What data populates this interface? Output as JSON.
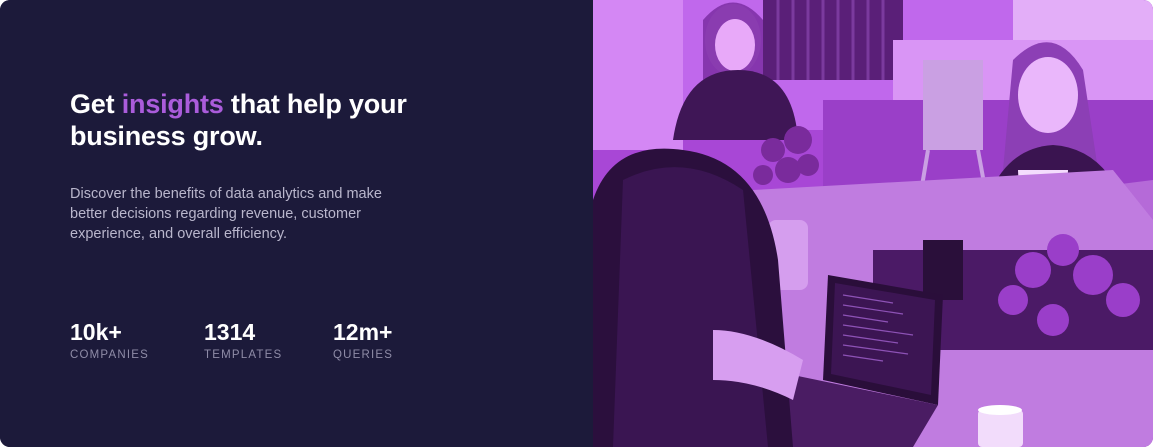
{
  "hero": {
    "headline_start": "Get ",
    "headline_accent": "insights",
    "headline_line1_end": " that help your",
    "headline_line2": "business grow.",
    "description": "Discover the benefits of data analytics and make better decisions regarding revenue, customer experience, and overall efficiency."
  },
  "stats": [
    {
      "value": "10k+",
      "label": "COMPANIES"
    },
    {
      "value": "1314",
      "label": "TEMPLATES"
    },
    {
      "value": "12m+",
      "label": "QUERIES"
    }
  ],
  "colors": {
    "background": "#1c1a3a",
    "accent": "#aa5cdb",
    "photo_tint": "#b74fe6"
  },
  "image": {
    "icon": "office-team-photo"
  }
}
